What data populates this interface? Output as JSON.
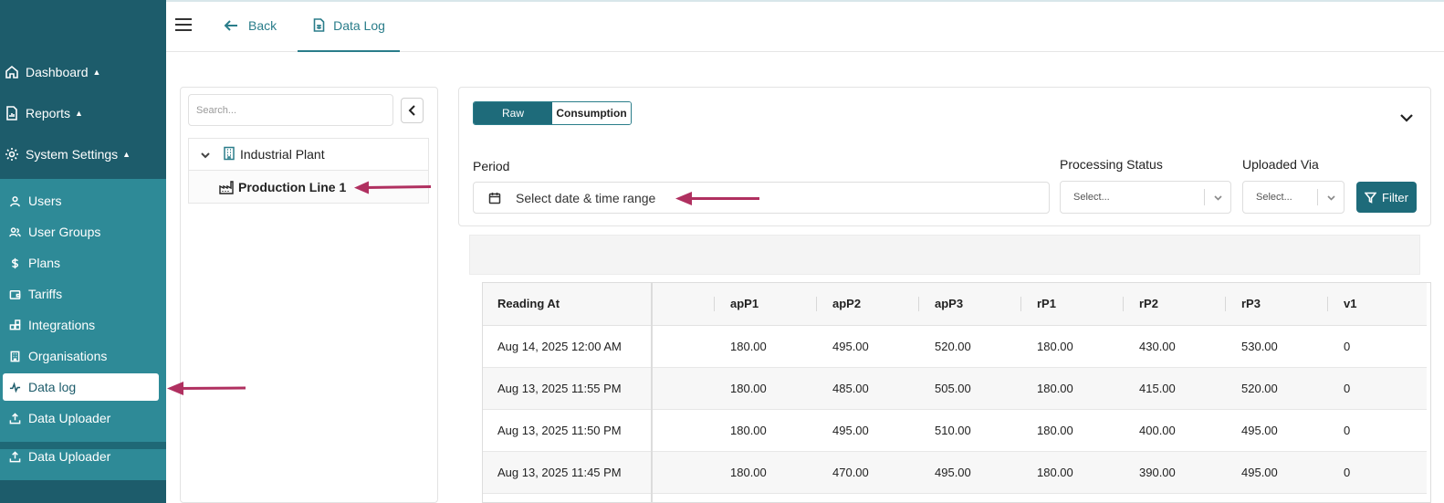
{
  "sidebar": {
    "items": [
      {
        "label": "Dashboard",
        "icon": "home-icon"
      },
      {
        "label": "Reports",
        "icon": "report-icon"
      },
      {
        "label": "System Settings",
        "icon": "gear-icon"
      }
    ],
    "sub_items": [
      {
        "label": "Users",
        "icon": "user-icon"
      },
      {
        "label": "User Groups",
        "icon": "user-group-icon"
      },
      {
        "label": "Plans",
        "icon": "dollar-icon"
      },
      {
        "label": "Tariffs",
        "icon": "wallet-icon"
      },
      {
        "label": "Integrations",
        "icon": "integrations-icon"
      },
      {
        "label": "Organisations",
        "icon": "building-icon"
      },
      {
        "label": "Data log",
        "icon": "activity-icon"
      },
      {
        "label": "Data Uploader",
        "icon": "upload-icon"
      }
    ],
    "extra_item": {
      "label": "Data Uploader",
      "icon": "upload-icon"
    },
    "active_item": "Data log",
    "colors": {
      "dark": "#1d5c6b",
      "light": "#2e8a97"
    }
  },
  "topbar": {
    "back_label": "Back",
    "tab_label": "Data Log"
  },
  "tree": {
    "search_placeholder": "Search...",
    "root_label": "Industrial Plant",
    "child_label": "Production Line 1"
  },
  "filters": {
    "toggle_raw": "Raw",
    "toggle_consumption": "Consumption",
    "period_label": "Period",
    "period_placeholder": "Select date & time range",
    "processing_status_label": "Processing Status",
    "processing_status_value": "Select...",
    "uploaded_via_label": "Uploaded Via",
    "uploaded_via_value": "Select...",
    "filter_button": "Filter"
  },
  "table": {
    "columns": [
      "Reading At",
      "",
      "apP1",
      "apP2",
      "apP3",
      "rP1",
      "rP2",
      "rP3",
      "v1"
    ],
    "rows": [
      [
        "Aug 14, 2025 12:00 AM",
        "",
        "180.00",
        "495.00",
        "520.00",
        "180.00",
        "430.00",
        "530.00",
        "0"
      ],
      [
        "Aug 13, 2025 11:55 PM",
        "",
        "180.00",
        "485.00",
        "505.00",
        "180.00",
        "415.00",
        "520.00",
        "0"
      ],
      [
        "Aug 13, 2025 11:50 PM",
        "",
        "180.00",
        "495.00",
        "510.00",
        "180.00",
        "400.00",
        "495.00",
        "0"
      ],
      [
        "Aug 13, 2025 11:45 PM",
        "",
        "180.00",
        "470.00",
        "495.00",
        "180.00",
        "390.00",
        "495.00",
        "0"
      ]
    ]
  },
  "colors": {
    "accent": "#1e6b7a",
    "arrow": "#b03060"
  }
}
